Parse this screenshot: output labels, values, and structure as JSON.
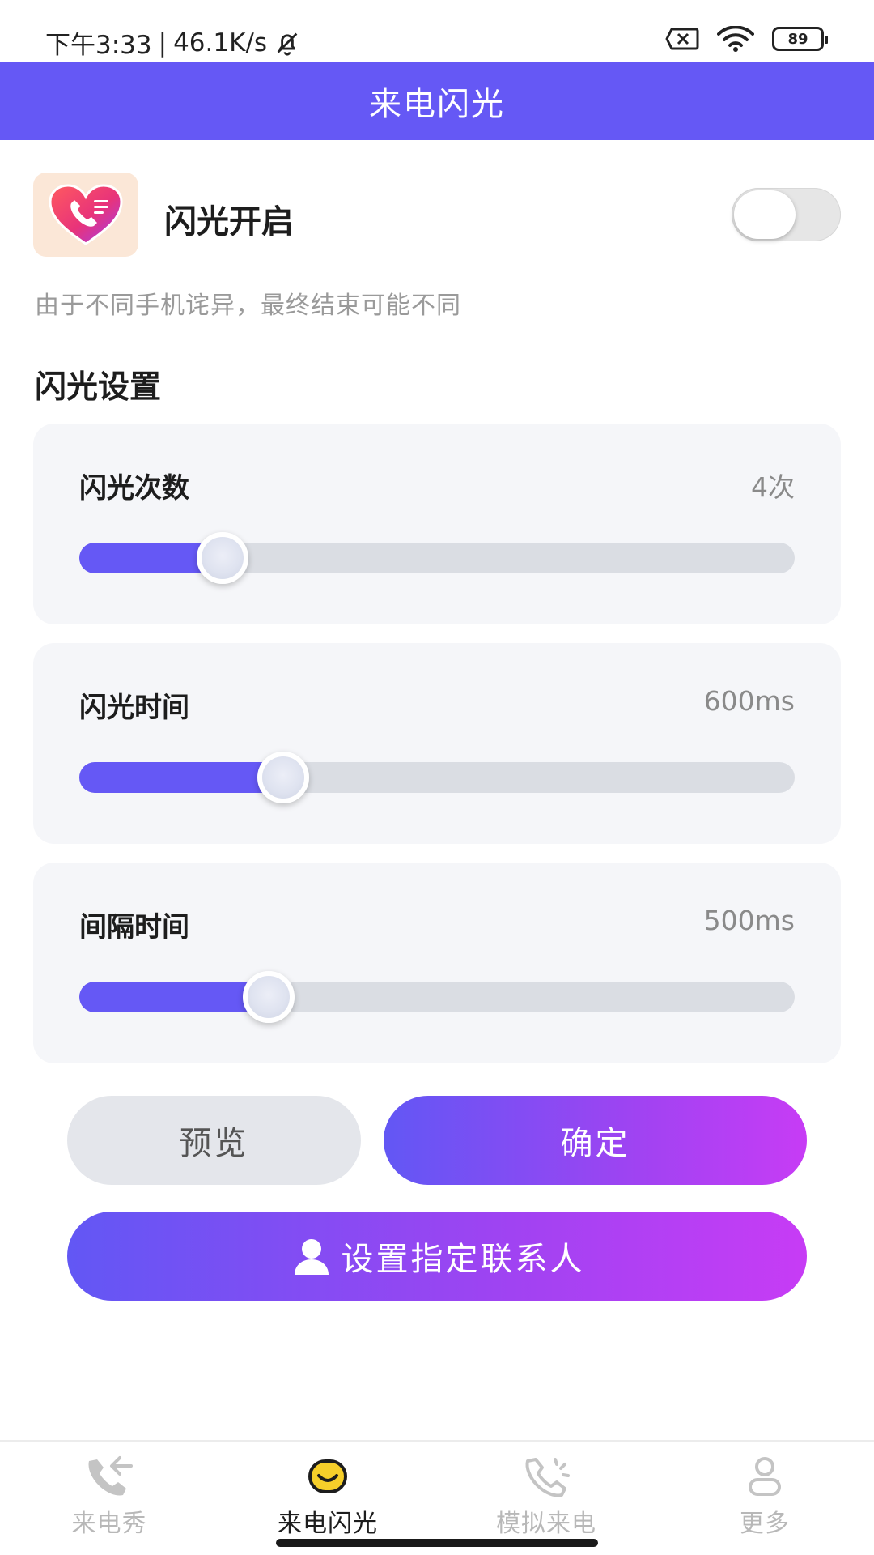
{
  "status_bar": {
    "time": "下午3:33",
    "separator": "|",
    "network_speed": "46.1K/s",
    "battery_level": "89",
    "icons": [
      "bell-off-icon",
      "sim-x-icon",
      "wifi-icon",
      "battery-icon"
    ]
  },
  "app_bar": {
    "title": "来电闪光",
    "color": "#6558f5"
  },
  "flash_toggle": {
    "label": "闪光开启",
    "enabled": false,
    "icon": "heart-phone-app-icon"
  },
  "hint": "由于不同手机诧异，最终结束可能不同",
  "section_title": "闪光设置",
  "settings": [
    {
      "label": "闪光次数",
      "value_text": "4次",
      "fraction": 0.2
    },
    {
      "label": "闪光时间",
      "value_text": "600ms",
      "fraction": 0.285
    },
    {
      "label": "间隔时间",
      "value_text": "500ms",
      "fraction": 0.265
    }
  ],
  "buttons": {
    "preview": "预览",
    "confirm": "确定",
    "set_contact": "设置指定联系人"
  },
  "colors": {
    "accent": "#6558f5",
    "gradient_start": "#6257f4",
    "gradient_end": "#c73cf5"
  },
  "bottom_nav": [
    {
      "label": "来电秀",
      "icon": "phone-incoming-icon",
      "active": false
    },
    {
      "label": "来电闪光",
      "icon": "smile-flash-icon",
      "active": true
    },
    {
      "label": "模拟来电",
      "icon": "phone-ringing-icon",
      "active": false
    },
    {
      "label": "更多",
      "icon": "user-icon",
      "active": false
    }
  ]
}
